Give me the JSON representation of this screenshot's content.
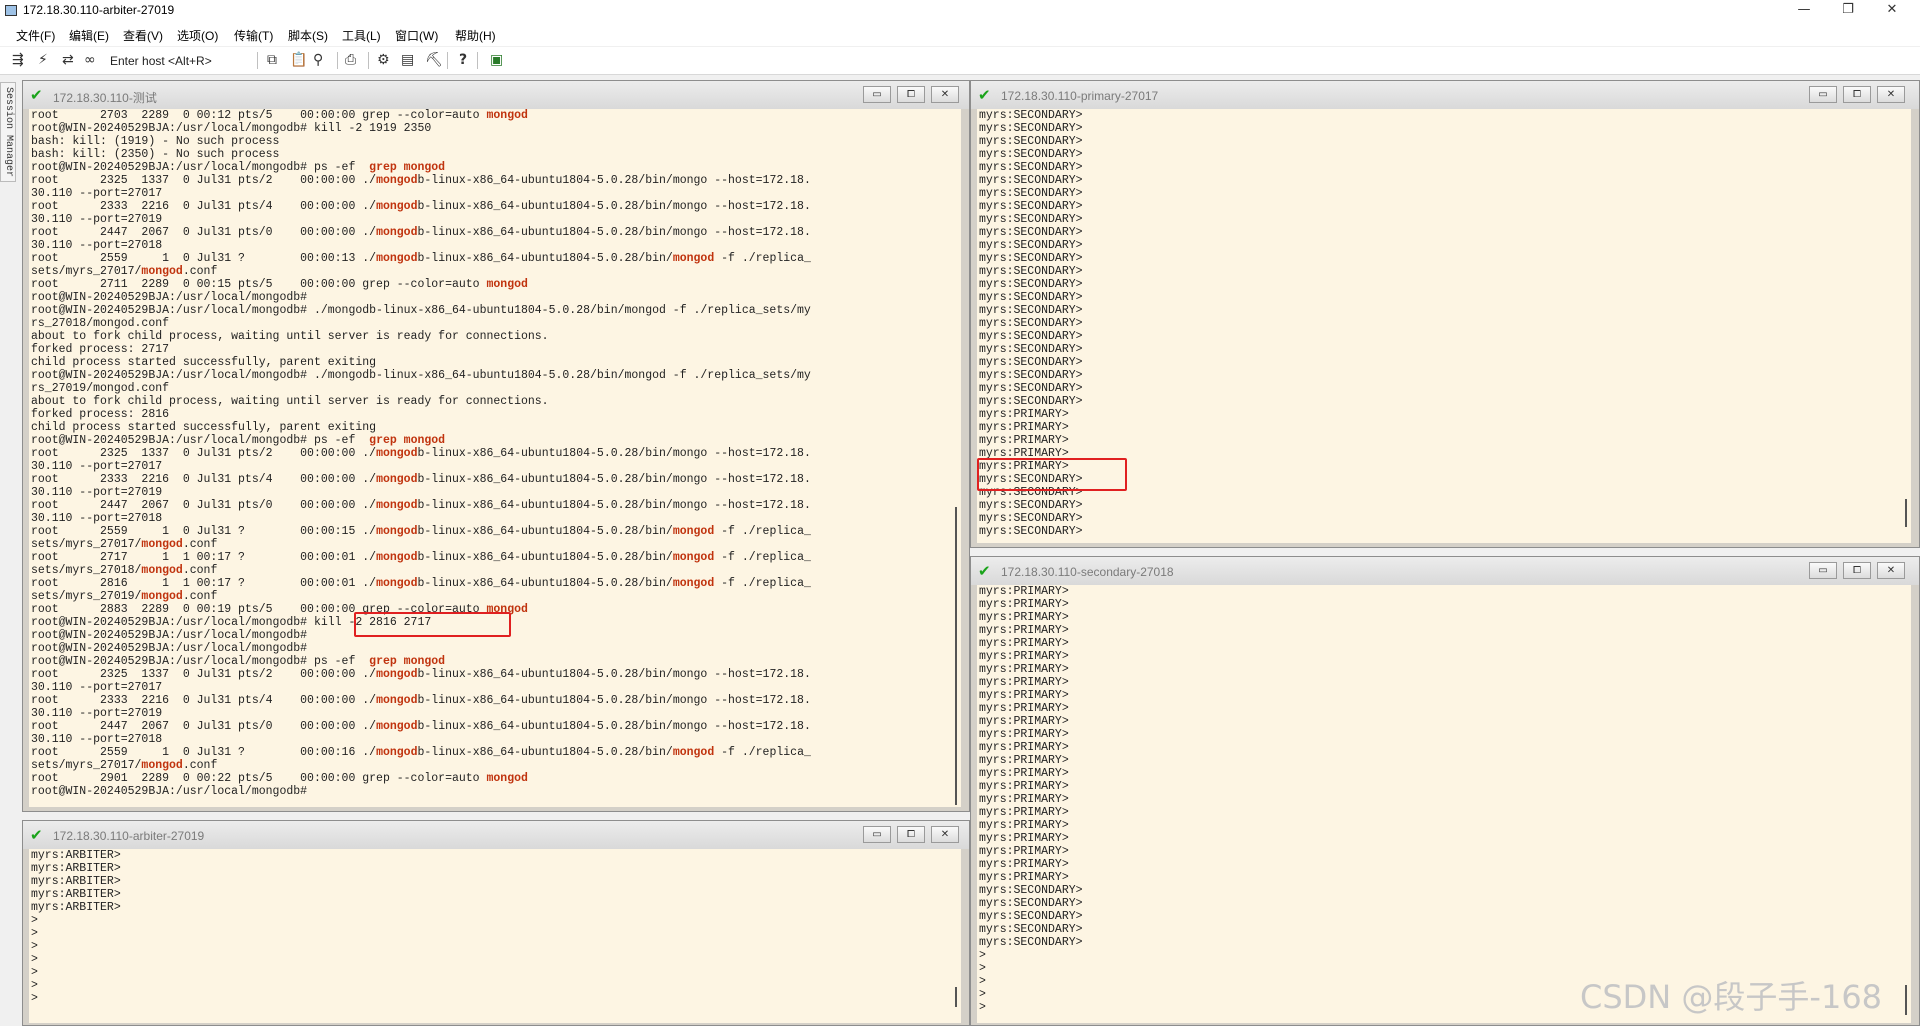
{
  "window": {
    "title": "172.18.30.110-arbiter-27019",
    "controls": {
      "minimize": "—",
      "restore": "❐",
      "close": "✕"
    }
  },
  "menu": [
    "文件(F)",
    "编辑(E)",
    "查看(V)",
    "选项(O)",
    "传输(T)",
    "脚本(S)",
    "工具(L)",
    "窗口(W)",
    "帮助(H)"
  ],
  "toolbar": {
    "host_placeholder": "Enter host <Alt+R>",
    "icons": [
      "connect-icon",
      "quick-connect-icon",
      "reconnect-icon",
      "link-icon",
      "copy-icon",
      "paste-icon",
      "find-icon",
      "print-icon",
      "settings-icon",
      "keymap-icon",
      "sftp-icon",
      "help-icon",
      "script-icon"
    ],
    "glyphs": {
      "connect": "⇶",
      "quick": "⚡",
      "reconnect": "⇄",
      "link": "∞",
      "copy": "⧉",
      "paste": "📋",
      "find": "⚲",
      "print": "⎙",
      "settings": "⚙",
      "keymap": "▤",
      "sftp": "⛏",
      "help": "?",
      "script": "▣"
    }
  },
  "session_manager_label": "Session Manager",
  "pane_buttons": {
    "minimize": "▭",
    "maximize": "⧠",
    "close": "✕"
  },
  "panes": {
    "test": {
      "title": "172.18.30.110-测试",
      "lines": [
        "root      2703  2289  0 00:12 pts/5    00:00:00 grep --color=auto |mongod|",
        "root@WIN-20240529BJA:/usr/local/mongodb# kill -2 1919 2350",
        "bash: kill: (1919) - No such process",
        "bash: kill: (2350) - No such process",
        "root@WIN-20240529BJA:/usr/local/mongodb# ps -ef | grep mongod",
        "root      2325  1337  0 Jul31 pts/2    00:00:00 ./|mongod|b-linux-x86_64-ubuntu1804-5.0.28/bin/mongo --host=172.18.",
        "30.110 --port=27017",
        "root      2333  2216  0 Jul31 pts/4    00:00:00 ./|mongod|b-linux-x86_64-ubuntu1804-5.0.28/bin/mongo --host=172.18.",
        "30.110 --port=27019",
        "root      2447  2067  0 Jul31 pts/0    00:00:00 ./|mongod|b-linux-x86_64-ubuntu1804-5.0.28/bin/mongo --host=172.18.",
        "30.110 --port=27018",
        "root      2559     1  0 Jul31 ?        00:00:13 ./|mongod|b-linux-x86_64-ubuntu1804-5.0.28/bin/|mongod| -f ./replica_",
        "sets/myrs_27017/|mongod|.conf",
        "root      2711  2289  0 00:15 pts/5    00:00:00 grep --color=auto |mongod|",
        "root@WIN-20240529BJA:/usr/local/mongodb#",
        "root@WIN-20240529BJA:/usr/local/mongodb# ./mongodb-linux-x86_64-ubuntu1804-5.0.28/bin/mongod -f ./replica_sets/my",
        "rs_27018/mongod.conf",
        "about to fork child process, waiting until server is ready for connections.",
        "forked process: 2717",
        "child process started successfully, parent exiting",
        "root@WIN-20240529BJA:/usr/local/mongodb# ./mongodb-linux-x86_64-ubuntu1804-5.0.28/bin/mongod -f ./replica_sets/my",
        "rs_27019/mongod.conf",
        "about to fork child process, waiting until server is ready for connections.",
        "forked process: 2816",
        "child process started successfully, parent exiting",
        "root@WIN-20240529BJA:/usr/local/mongodb# ps -ef | grep mongod",
        "root      2325  1337  0 Jul31 pts/2    00:00:00 ./|mongod|b-linux-x86_64-ubuntu1804-5.0.28/bin/mongo --host=172.18.",
        "30.110 --port=27017",
        "root      2333  2216  0 Jul31 pts/4    00:00:00 ./|mongod|b-linux-x86_64-ubuntu1804-5.0.28/bin/mongo --host=172.18.",
        "30.110 --port=27019",
        "root      2447  2067  0 Jul31 pts/0    00:00:00 ./|mongod|b-linux-x86_64-ubuntu1804-5.0.28/bin/mongo --host=172.18.",
        "30.110 --port=27018",
        "root      2559     1  0 Jul31 ?        00:00:15 ./|mongod|b-linux-x86_64-ubuntu1804-5.0.28/bin/|mongod| -f ./replica_",
        "sets/myrs_27017/|mongod|.conf",
        "root      2717     1  1 00:17 ?        00:00:01 ./|mongod|b-linux-x86_64-ubuntu1804-5.0.28/bin/|mongod| -f ./replica_",
        "sets/myrs_27018/|mongod|.conf",
        "root      2816     1  1 00:17 ?        00:00:01 ./|mongod|b-linux-x86_64-ubuntu1804-5.0.28/bin/|mongod| -f ./replica_",
        "sets/myrs_27019/|mongod|.conf",
        "root      2883  2289  0 00:19 pts/5    00:00:00 grep --color=auto |mongod|",
        "root@WIN-20240529BJA:/usr/local/mongodb# kill -2 2816 2717",
        "root@WIN-20240529BJA:/usr/local/mongodb#",
        "root@WIN-20240529BJA:/usr/local/mongodb#",
        "root@WIN-20240529BJA:/usr/local/mongodb# ps -ef | grep mongod",
        "root      2325  1337  0 Jul31 pts/2    00:00:00 ./|mongod|b-linux-x86_64-ubuntu1804-5.0.28/bin/mongo --host=172.18.",
        "30.110 --port=27017",
        "root      2333  2216  0 Jul31 pts/4    00:00:00 ./|mongod|b-linux-x86_64-ubuntu1804-5.0.28/bin/mongo --host=172.18.",
        "30.110 --port=27019",
        "root      2447  2067  0 Jul31 pts/0    00:00:00 ./|mongod|b-linux-x86_64-ubuntu1804-5.0.28/bin/mongo --host=172.18.",
        "30.110 --port=27018",
        "root      2559     1  0 Jul31 ?        00:00:16 ./|mongod|b-linux-x86_64-ubuntu1804-5.0.28/bin/|mongod| -f ./replica_",
        "sets/myrs_27017/|mongod|.conf",
        "root      2901  2289  0 00:22 pts/5    00:00:00 grep --color=auto |mongod|",
        "root@WIN-20240529BJA:/usr/local/mongodb#"
      ]
    },
    "arbiter": {
      "title": "172.18.30.110-arbiter-27019",
      "lines": [
        "myrs:ARBITER>",
        "myrs:ARBITER>",
        "myrs:ARBITER>",
        "myrs:ARBITER>",
        "myrs:ARBITER>",
        ">",
        ">",
        ">",
        ">",
        ">",
        ">",
        ">"
      ]
    },
    "primary": {
      "title": "172.18.30.110-primary-27017",
      "lines": [
        "myrs:SECONDARY>",
        "myrs:SECONDARY>",
        "myrs:SECONDARY>",
        "myrs:SECONDARY>",
        "myrs:SECONDARY>",
        "myrs:SECONDARY>",
        "myrs:SECONDARY>",
        "myrs:SECONDARY>",
        "myrs:SECONDARY>",
        "myrs:SECONDARY>",
        "myrs:SECONDARY>",
        "myrs:SECONDARY>",
        "myrs:SECONDARY>",
        "myrs:SECONDARY>",
        "myrs:SECONDARY>",
        "myrs:SECONDARY>",
        "myrs:SECONDARY>",
        "myrs:SECONDARY>",
        "myrs:SECONDARY>",
        "myrs:SECONDARY>",
        "myrs:SECONDARY>",
        "myrs:SECONDARY>",
        "myrs:SECONDARY>",
        "myrs:PRIMARY>",
        "myrs:PRIMARY>",
        "myrs:PRIMARY>",
        "myrs:PRIMARY>",
        "myrs:PRIMARY>",
        "myrs:SECONDARY>",
        "myrs:SECONDARY>",
        "myrs:SECONDARY>",
        "myrs:SECONDARY>",
        "myrs:SECONDARY>"
      ]
    },
    "secondary": {
      "title": "172.18.30.110-secondary-27018",
      "lines": [
        "myrs:PRIMARY>",
        "myrs:PRIMARY>",
        "myrs:PRIMARY>",
        "myrs:PRIMARY>",
        "myrs:PRIMARY>",
        "myrs:PRIMARY>",
        "myrs:PRIMARY>",
        "myrs:PRIMARY>",
        "myrs:PRIMARY>",
        "myrs:PRIMARY>",
        "myrs:PRIMARY>",
        "myrs:PRIMARY>",
        "myrs:PRIMARY>",
        "myrs:PRIMARY>",
        "myrs:PRIMARY>",
        "myrs:PRIMARY>",
        "myrs:PRIMARY>",
        "myrs:PRIMARY>",
        "myrs:PRIMARY>",
        "myrs:PRIMARY>",
        "myrs:PRIMARY>",
        "myrs:PRIMARY>",
        "myrs:PRIMARY>",
        "myrs:SECONDARY>",
        "myrs:SECONDARY>",
        "myrs:SECONDARY>",
        "myrs:SECONDARY>",
        "myrs:SECONDARY>",
        ">",
        ">",
        ">",
        ">",
        ">"
      ]
    }
  },
  "watermark": "CSDN @段子手-168",
  "colors": {
    "terminal_bg": "#fdf5e3",
    "highlight": "#c0330e",
    "annotation": "#e02020",
    "connected": "#1aa31a"
  }
}
